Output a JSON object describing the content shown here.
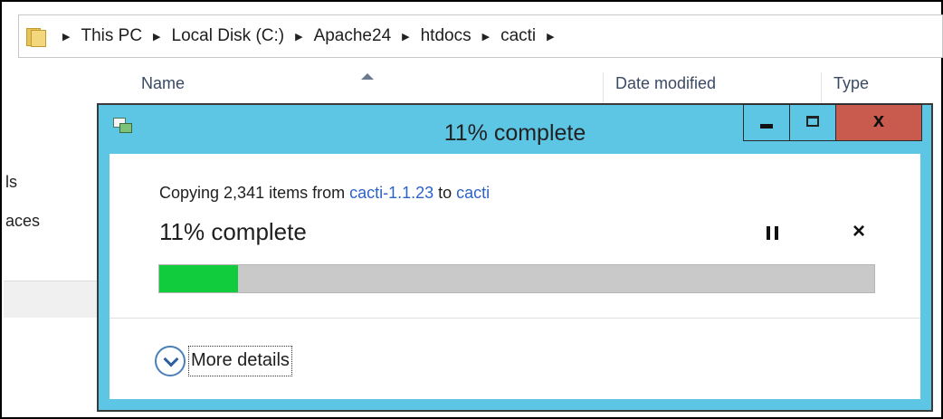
{
  "explorer": {
    "breadcrumb": [
      "This PC",
      "Local Disk (C:)",
      "Apache24",
      "htdocs",
      "cacti"
    ],
    "columns": [
      "Name",
      "Date modified",
      "Type"
    ],
    "nav_fragments": [
      "ls",
      "aces"
    ]
  },
  "dialog": {
    "title": "11% complete",
    "copy_prefix": "Copying 2,341 items from ",
    "source": "cacti-1.1.23",
    "to_word": " to ",
    "destination": "cacti",
    "status": "11% complete",
    "progress_fraction": 0.11,
    "more_details_label": "More details",
    "cancel_glyph": "×",
    "close_glyph": "x",
    "colors": {
      "titlebar": "#5ec6e5",
      "progress_fill": "#11cc3d",
      "progress_track": "#c9c9c9",
      "close_button": "#c85a4e",
      "link": "#2d63c8"
    },
    "icons": [
      "copy-icon",
      "minimize-icon",
      "maximize-icon",
      "close-icon",
      "pause-icon",
      "cancel-icon",
      "chevron-down-icon",
      "folder-icon"
    ]
  }
}
